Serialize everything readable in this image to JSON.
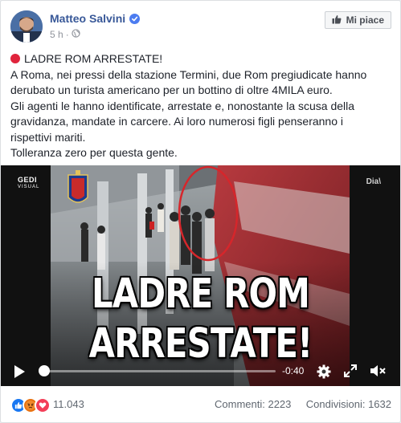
{
  "post": {
    "author": "Matteo Salvini",
    "time": "5 h",
    "time_separator": "·",
    "like_page_label": "Mi piace",
    "text_lines": [
      "LADRE ROM ARRESTATE!",
      "A Roma, nei pressi della stazione Termini, due Rom pregiudicate hanno",
      "derubato un turista americano per un bottino di oltre 4MILA euro.",
      "Gli agenti le hanno identificate, arrestate e, nonostante la scusa della",
      "gravidanza, mandate in carcere. Ai loro numerosi figli penseranno i",
      "rispettivi mariti.",
      "Tolleranza zero per questa gente."
    ]
  },
  "video": {
    "overlay_line1": "LADRE ROM",
    "overlay_line2": "ARRESTATE!",
    "watermark_left": "GEDI",
    "watermark_left_sub": "VISUAL",
    "watermark_right": "Dia\\",
    "time_remaining": "-0:40",
    "progress": 0.0,
    "icons": {
      "play": "play-icon",
      "settings": "gear-icon",
      "fullscreen": "expand-icon",
      "volume": "volume-muted-icon"
    }
  },
  "footer": {
    "reaction_count": "11.043",
    "comments_label": "Commenti: 2223",
    "shares_label": "Condivisioni: 1632",
    "reactions": [
      {
        "name": "like-reaction-icon",
        "color": "#1877f2"
      },
      {
        "name": "angry-reaction-icon",
        "color": "#e9710f"
      },
      {
        "name": "love-reaction-icon",
        "color": "#f33e58"
      }
    ]
  },
  "colors": {
    "author_link": "#385898",
    "meta_gray": "#90949c",
    "verified_badge": "#4c7cf0",
    "red_circle_emoji": "#e0243c"
  }
}
